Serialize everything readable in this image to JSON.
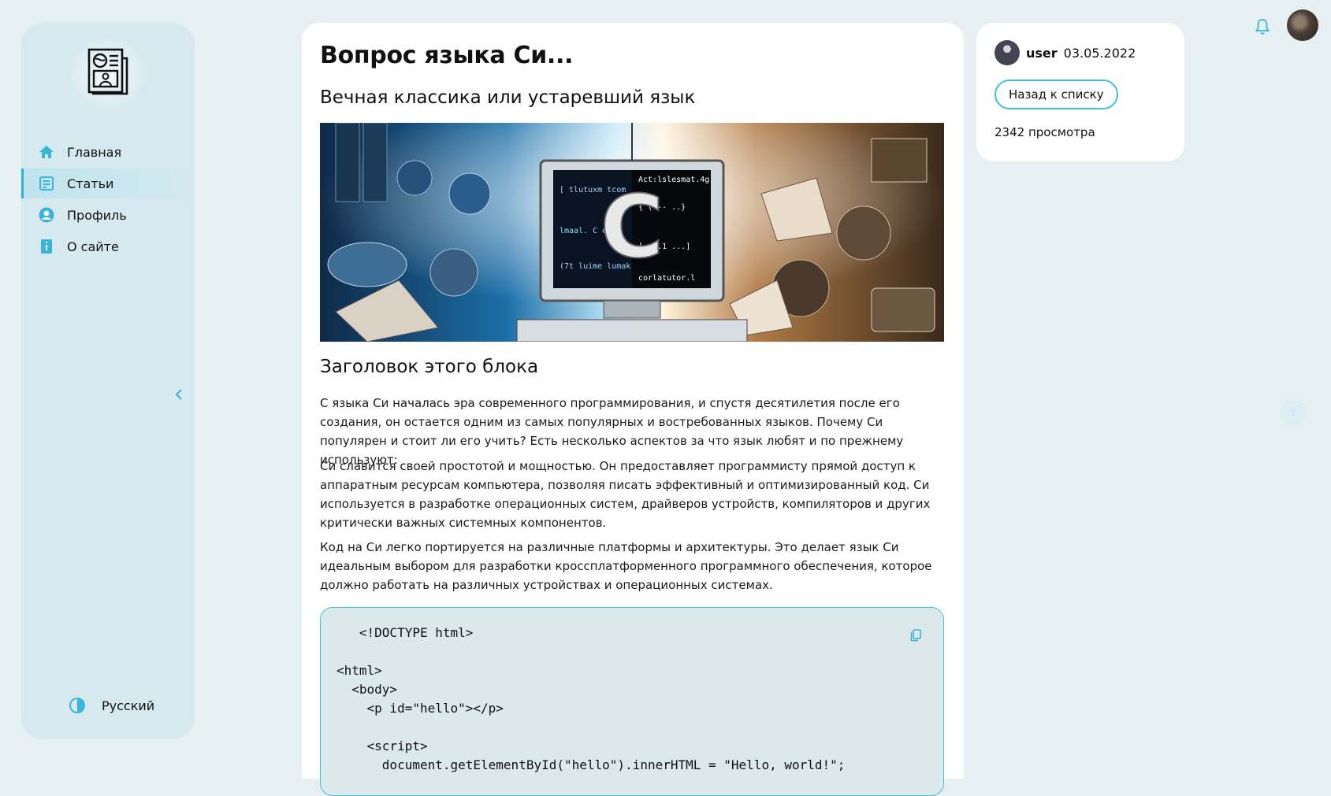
{
  "sidebar": {
    "logo_icon": "newspaper-icon",
    "items": [
      {
        "label": "Главная",
        "icon": "home-icon"
      },
      {
        "label": "Статьи",
        "icon": "article-icon",
        "active": true
      },
      {
        "label": "Профиль",
        "icon": "profile-icon"
      },
      {
        "label": "О сайте",
        "icon": "info-icon"
      }
    ],
    "language": "Русский"
  },
  "article": {
    "title": "Вопрос языка Си...",
    "subtitle": "Вечная классика или устаревший язык",
    "hero_image_alt": "С",
    "block_title": "Заголовок этого блока",
    "paragraphs": [
      "С языка Си началась эра современного программирования, и спустя десятилетия после его создания, он остается одним из самых популярных и востребованных языков. Почему Си популярен и стоит ли его учить? Есть несколько аспектов за что язык любят и по прежнему используют:",
      "Си славится своей простотой и мощностью. Он предоставляет программисту прямой доступ к аппаратным ресурсам компьютера, позволяя писать эффективный и оптимизированный код. Си используется в разработке операционных систем, драйверов устройств, компиляторов и других критически важных системных компонентов.",
      "Код на Си легко портируется на различные платформы и архитектуры. Это делает язык Си идеальным выбором для разработки кроссплатформенного программного обеспечения, которое должно работать на различных устройствах и операционных системах."
    ],
    "code": "   <!DOCTYPE html>\n\n<html>\n  <body>\n    <p id=\"hello\"></p>\n\n    <script>\n      document.getElementById(\"hello\").innerHTML = \"Hello, world!\";"
  },
  "info": {
    "username": "user",
    "date": "03.05.2022",
    "back_label": "Назад к списку",
    "views": "2342 просмотра"
  },
  "colors": {
    "accent": "#2bb3d6",
    "sidebar_bg": "#d6e9ee",
    "page_bg": "#e6f0f2"
  }
}
